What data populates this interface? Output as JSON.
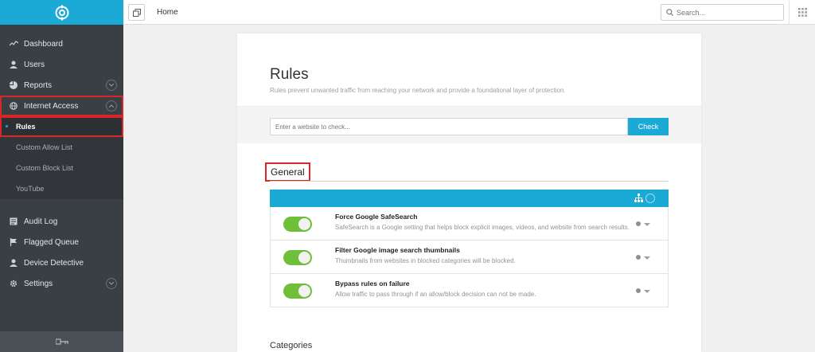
{
  "colors": {
    "accent": "#1ba9d6",
    "sidebar": "#3a3f44",
    "toggle_on": "#6fbf3b",
    "highlight": "#d9262b"
  },
  "sidebar": {
    "logo_icon": "target-logo-icon",
    "items": [
      {
        "label": "Dashboard",
        "icon": "activity-line-icon"
      },
      {
        "label": "Users",
        "icon": "user-icon"
      },
      {
        "label": "Reports",
        "icon": "pie-chart-icon"
      },
      {
        "label": "Internet Access",
        "icon": "globe-icon"
      }
    ],
    "internet_access_sub": [
      {
        "label": "Rules"
      },
      {
        "label": "Custom Allow List"
      },
      {
        "label": "Custom Block List"
      },
      {
        "label": "YouTube"
      }
    ],
    "items2": [
      {
        "label": "Audit Log",
        "icon": "log-icon"
      },
      {
        "label": "Flagged Queue",
        "icon": "flag-icon"
      },
      {
        "label": "Device Detective",
        "icon": "user-icon"
      },
      {
        "label": "Settings",
        "icon": "gear-icon"
      }
    ],
    "footer_icon": "key-icon"
  },
  "topbar": {
    "breadcrumb": "Home",
    "search_placeholder": "Search..."
  },
  "main": {
    "title": "Rules",
    "subtitle": "Rules prevent unwanted traffic from reaching your network and provide a foundational layer of protection.",
    "check_placeholder": "Enter a website to check...",
    "check_button": "Check",
    "section_general": "General",
    "rules": [
      {
        "name": "Force Google SafeSearch",
        "desc": "SafeSearch is a Google setting that helps block explicit images, videos, and website from search results.",
        "enabled": true
      },
      {
        "name": "Filter Google image search thumbnails",
        "desc": "Thumbnails from websites in blocked categories will be blocked.",
        "enabled": true
      },
      {
        "name": "Bypass rules on failure",
        "desc": "Allow traffic to pass through if an allow/block decision can not be made.",
        "enabled": true
      }
    ],
    "section_categories": "Categories"
  }
}
